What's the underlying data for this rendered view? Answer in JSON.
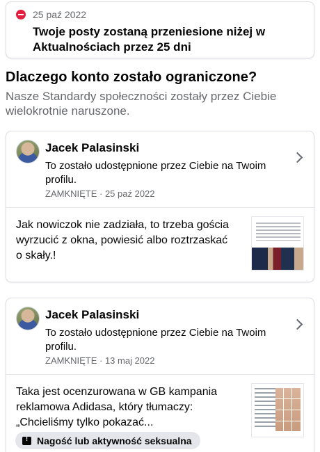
{
  "notice": {
    "date": "25 paź 2022",
    "text": "Twoje posty zostaną przeniesione niżej w Aktualnościach przez 25 dni",
    "icon": "stop-icon"
  },
  "section": {
    "heading": "Dlaczego konto zostało ograniczone?",
    "subheading": "Nasze Standardy społeczności zostały przez Ciebie wielokrotnie naruszone."
  },
  "posts": [
    {
      "author": "Jacek Palasinski",
      "shared_text": "To zostało udostępnione przez Ciebie na Twoim profilu.",
      "meta": "ZAMKNIĘTE · 25 paź 2022",
      "body": "Jak nowiczok nie zadziała, to trzeba gościa wyrzucić z okna, powiesić albo roztrzaskać o skały.!"
    },
    {
      "author": "Jacek Palasinski",
      "shared_text": "To zostało udostępnione przez Ciebie na Twoim profilu.",
      "meta": "ZAMKNIĘTE · 13 maj 2022",
      "body": "Taka jest ocenzurowana w GB kampania reklamowa Adidasa, który tłumaczy: „Chcieliśmy tylko pokazać...",
      "badge": "Nagość lub aktywność seksualna"
    }
  ],
  "colors": {
    "stop": "#e41e3f",
    "secondary_text": "#65676b",
    "badge_bg": "#e4e6eb"
  }
}
